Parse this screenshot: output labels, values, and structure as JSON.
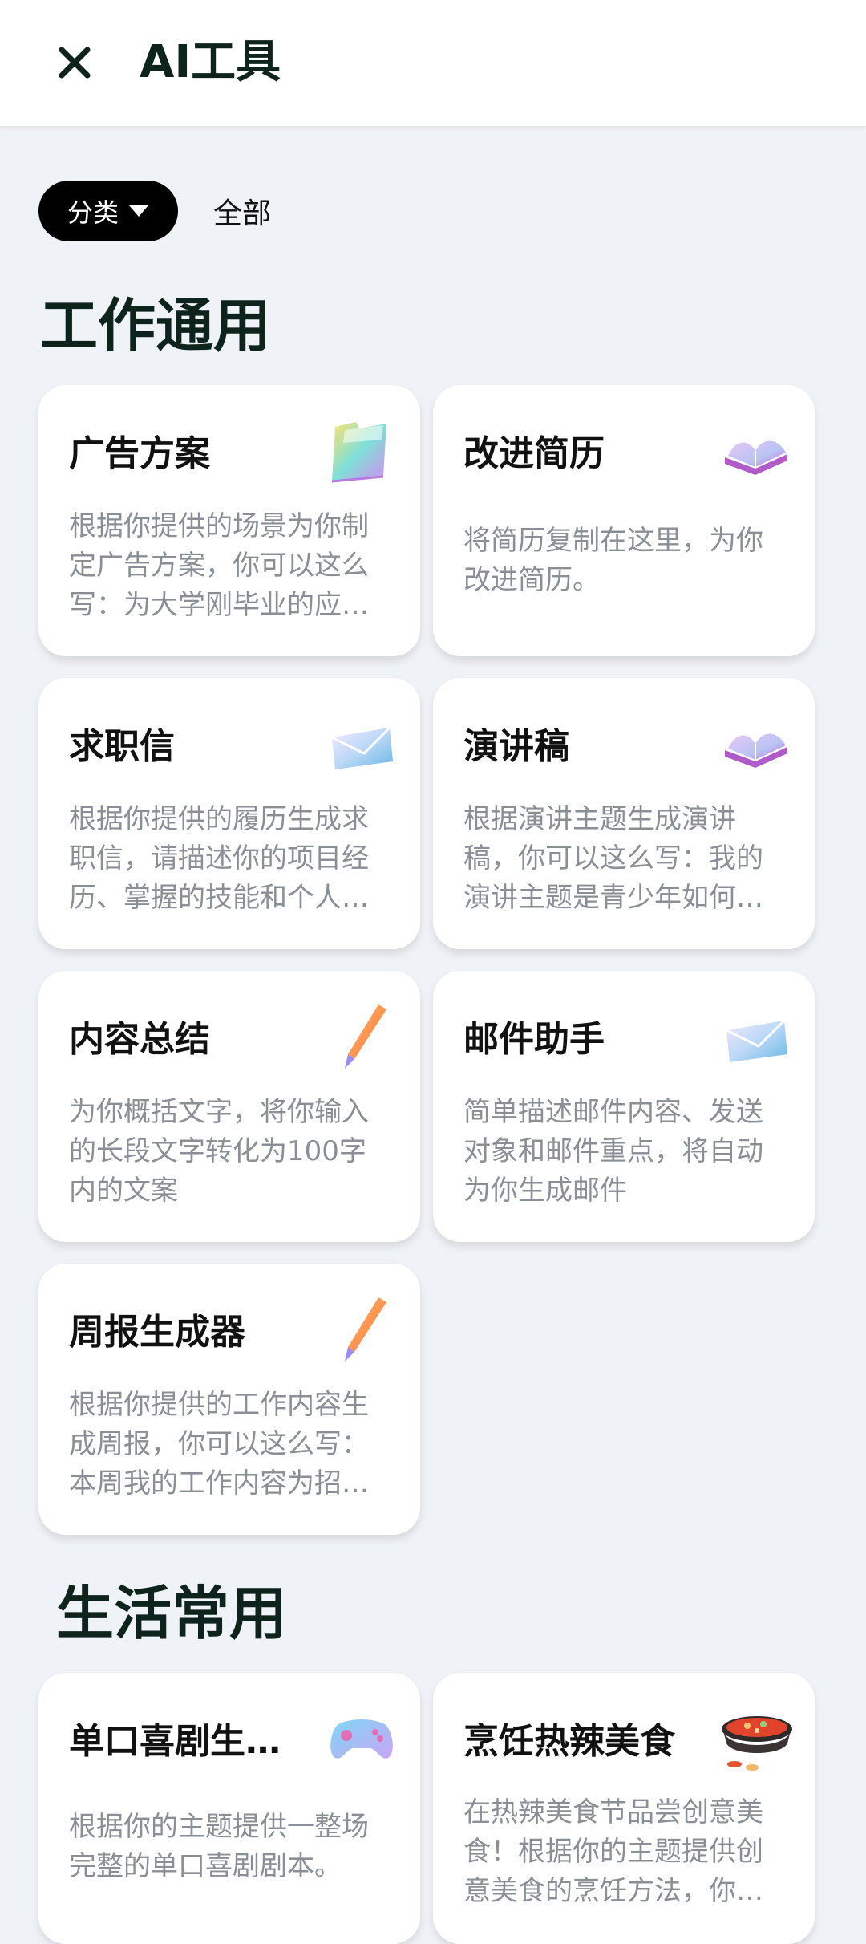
{
  "header": {
    "title": "AI工具",
    "close_icon": "close-icon"
  },
  "filter": {
    "category_label": "分类",
    "all_label": "全部"
  },
  "sections": [
    {
      "title": "工作通用",
      "cards": [
        {
          "title": "广告方案",
          "icon": "folder-icon",
          "desc": "根据你提供的场景为你制定广告方案，你可以这么写：为大学刚毕业的应届生撰写一份求职广告"
        },
        {
          "title": "改进简历",
          "icon": "book-icon",
          "desc": "将简历复制在这里，为你改进简历。"
        },
        {
          "title": "求职信",
          "icon": "envelope-icon",
          "desc": "根据你提供的履历生成求职信，请描述你的项目经历、掌握的技能和个人优势"
        },
        {
          "title": "演讲稿",
          "icon": "book-icon",
          "desc": "根据演讲主题生成演讲稿，你可以这么写：我的演讲主题是青少年如何保护环境"
        },
        {
          "title": "内容总结",
          "icon": "pen-icon",
          "desc": "为你概括文字，将你输入的长段文字转化为100字内的文案"
        },
        {
          "title": "邮件助手",
          "icon": "envelope-icon",
          "desc": "简单描述邮件内容、发送对象和邮件重点，将自动为你生成邮件"
        },
        {
          "title": "周报生成器",
          "icon": "pen-icon",
          "desc": "根据你提供的工作内容生成周报，你可以这么写：本周我的工作内容为招聘和培训新员工"
        }
      ]
    },
    {
      "title": "生活常用",
      "cards": [
        {
          "title": "单口喜剧生成器",
          "icon": "gamepad-icon",
          "desc": "根据你的主题提供一整场完整的单口喜剧剧本。"
        },
        {
          "title": "烹饪热辣美食",
          "icon": "hotpot-icon",
          "desc": "在热辣美食节品尝创意美食！根据你的主题提供创意美食的烹饪方法，你可以这么写"
        }
      ]
    }
  ]
}
